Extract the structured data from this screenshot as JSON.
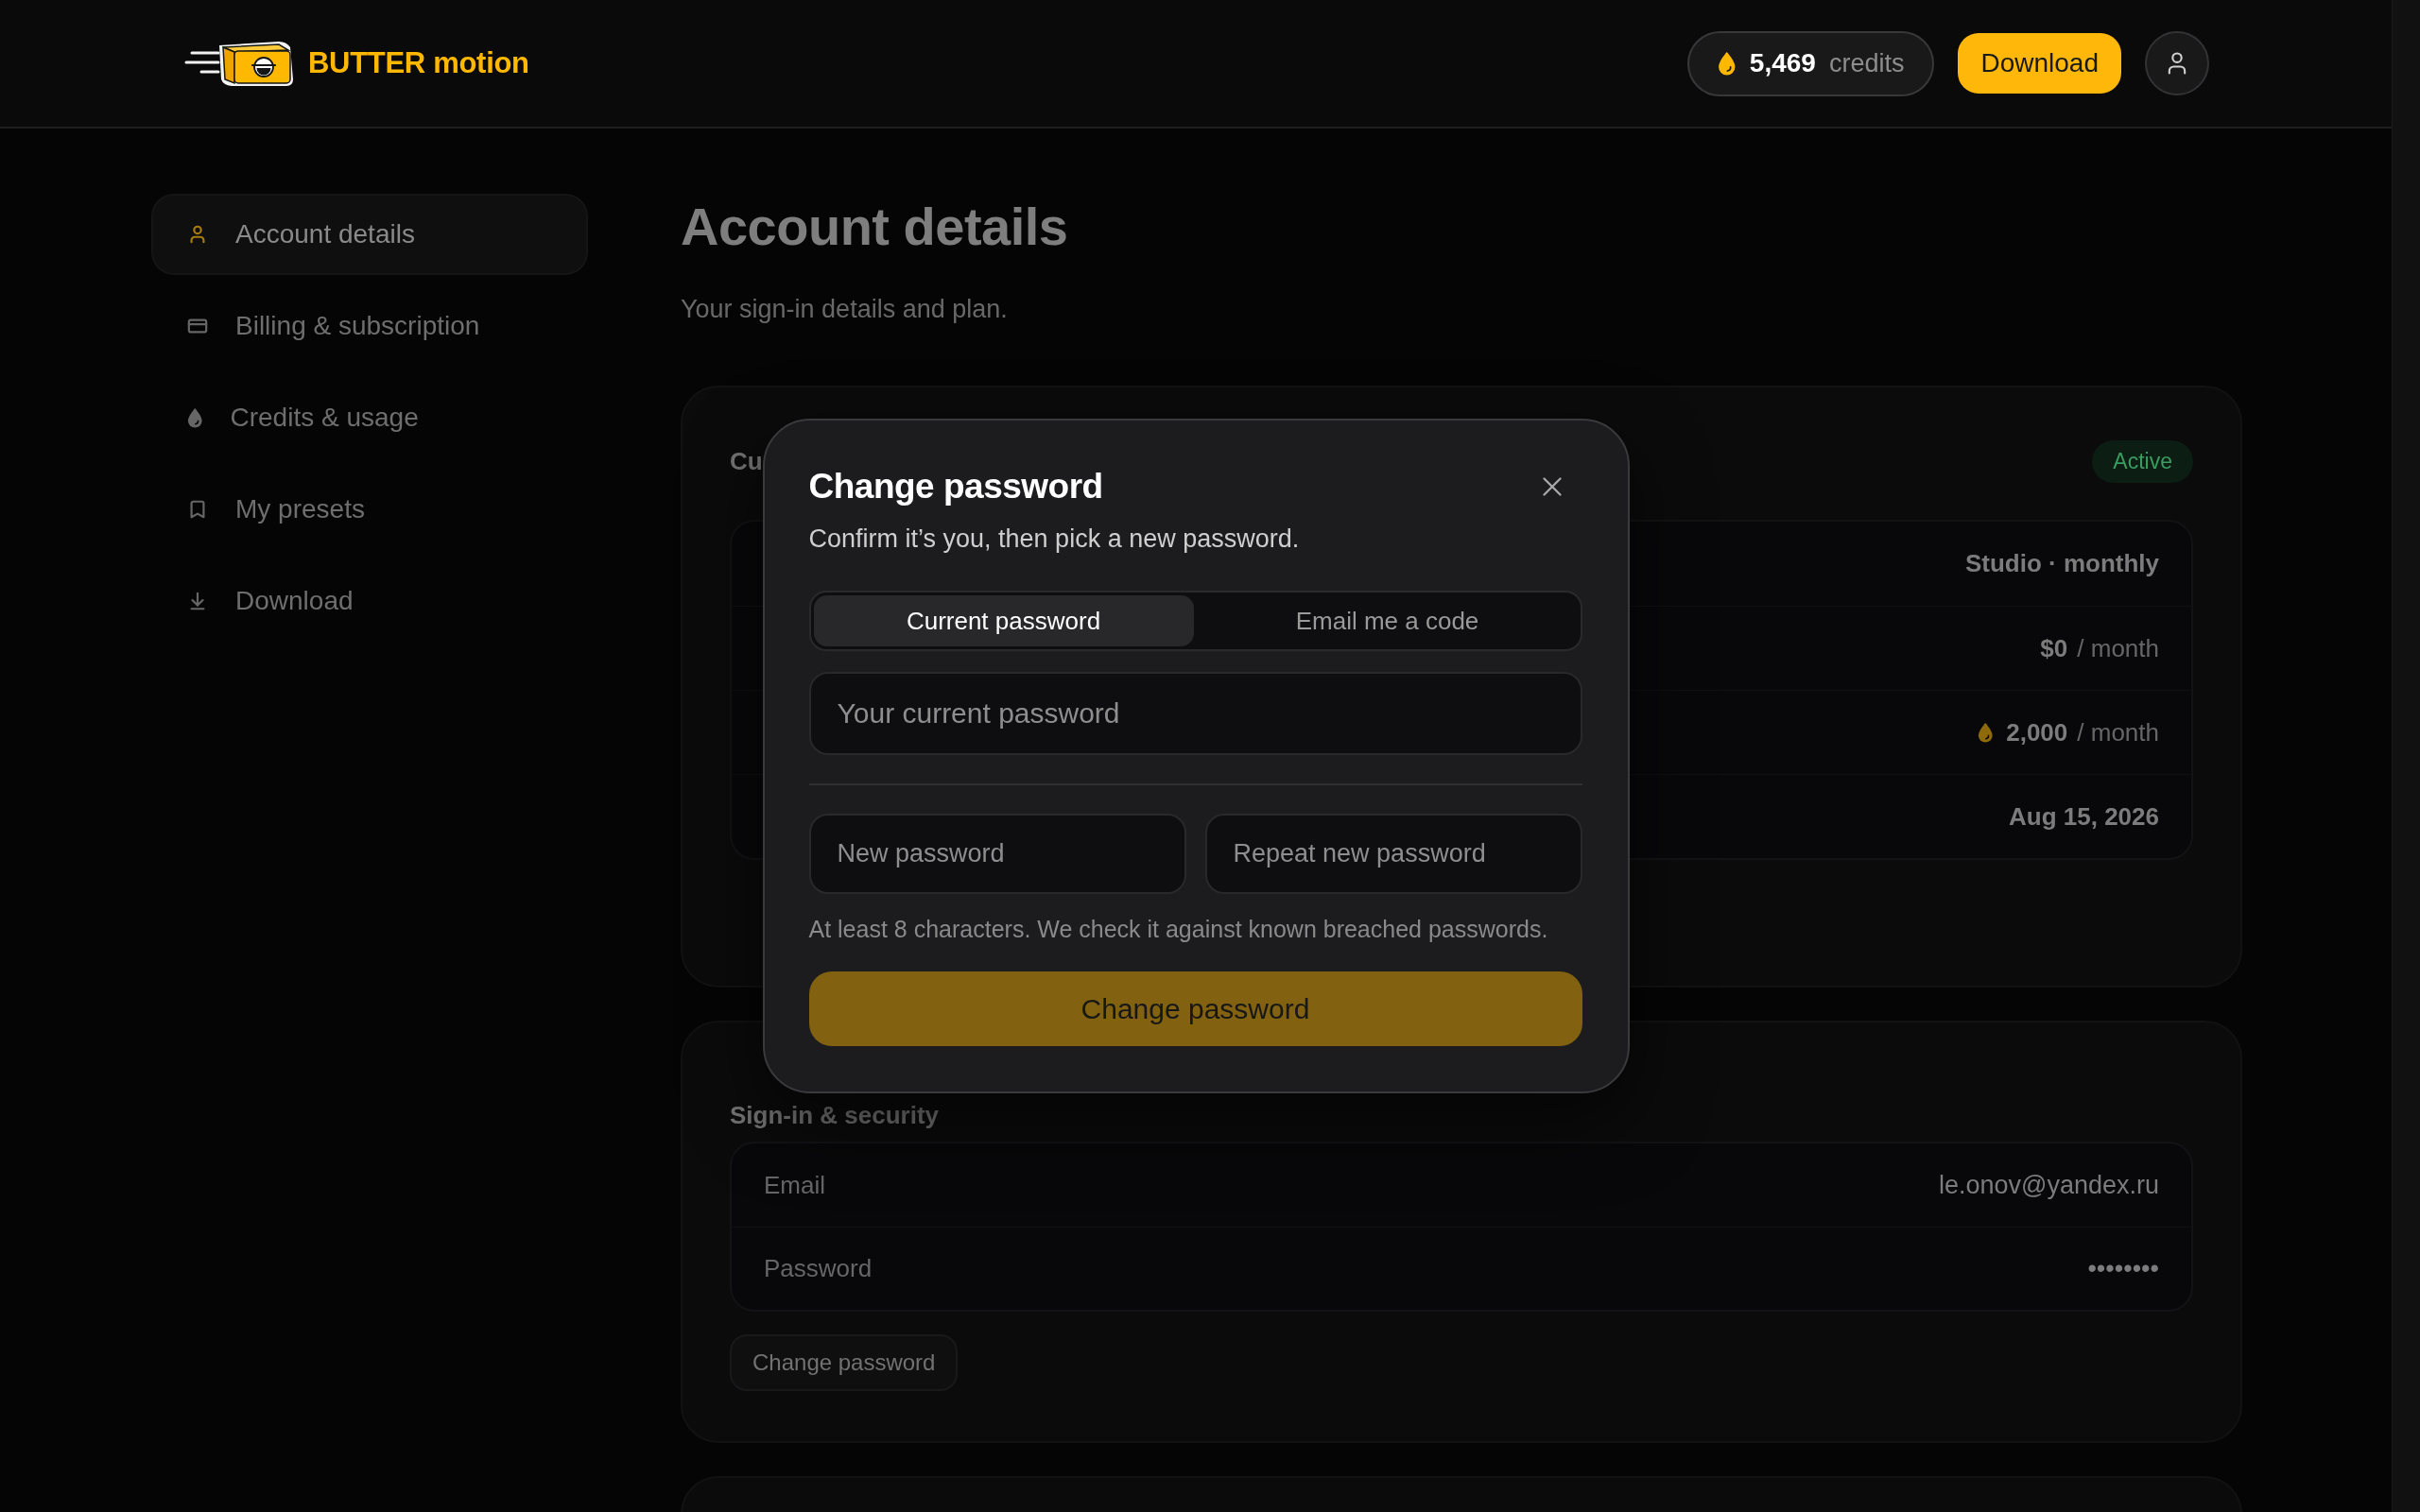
{
  "header": {
    "logo": {
      "text": "BUTTER motion"
    },
    "credits": {
      "amount": "5,469",
      "unit": "credits"
    },
    "download_button": {
      "label": "Download"
    }
  },
  "sidebar": {
    "items": [
      {
        "label": "Account details",
        "selected": true
      },
      {
        "label": "Billing & subscription",
        "selected": false
      },
      {
        "label": "Credits & usage",
        "selected": false
      },
      {
        "label": "My presets",
        "selected": false
      },
      {
        "label": "Download",
        "selected": false
      }
    ]
  },
  "page": {
    "title": "Account details",
    "subtitle": "Your sign-in details and plan."
  },
  "plan_card": {
    "title": "Cu",
    "badge": "Active",
    "rows": [
      {
        "kind": "text",
        "value": "Studio · monthly"
      },
      {
        "kind": "price",
        "amount": "$0",
        "unit": "/ month"
      },
      {
        "kind": "credits",
        "amount": "2,000",
        "unit": "/ month"
      },
      {
        "kind": "text",
        "value": "Aug 15, 2026"
      }
    ]
  },
  "signin_card": {
    "title": "Sign-in & security",
    "rows": [
      {
        "label": "Email",
        "value": "le.onov@yandex.ru"
      },
      {
        "label": "Password",
        "value": "••••••••"
      }
    ],
    "button": {
      "label": "Change password"
    }
  },
  "dialog": {
    "title": "Change password",
    "subtitle": "Confirm it’s you, then pick a new password.",
    "tabs": [
      {
        "label": "Current password",
        "selected": true
      },
      {
        "label": "Email me a code",
        "selected": false
      }
    ],
    "current_password": {
      "placeholder": "Your current password"
    },
    "new_password": {
      "placeholder": "New password"
    },
    "repeat_password": {
      "placeholder": "Repeat new password"
    },
    "hint": "At least 8 characters. We check it against known breached passwords.",
    "submit": {
      "label": "Change password",
      "disabled": true
    }
  }
}
